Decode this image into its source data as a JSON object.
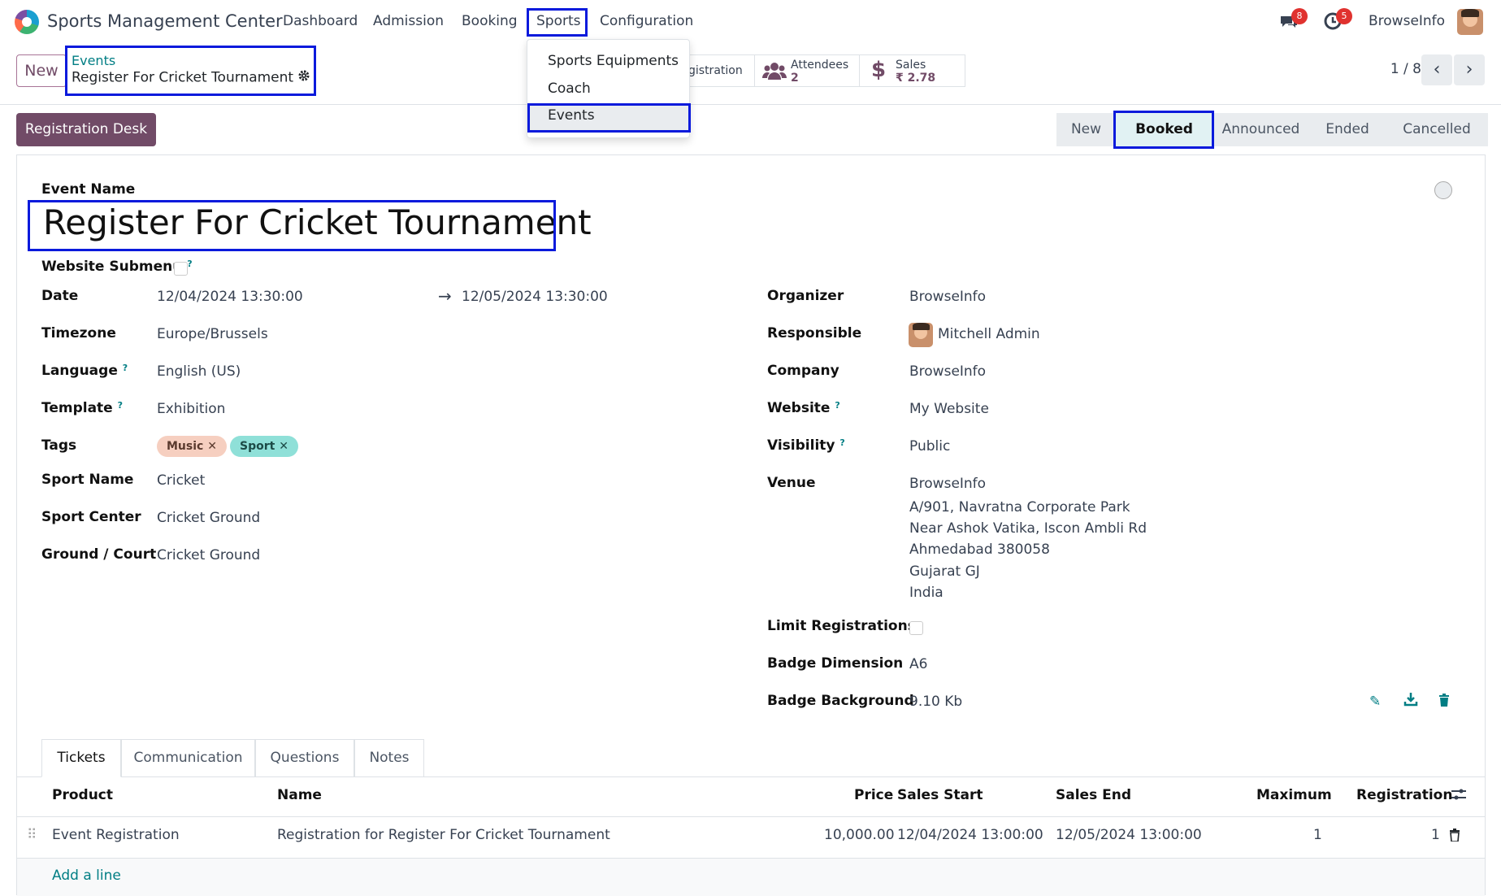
{
  "app": {
    "name": "Sports Management Center",
    "user": "BrowseInfo",
    "messages_count": "8",
    "activities_count": "5"
  },
  "menu": {
    "dashboard": "Dashboard",
    "admission": "Admission",
    "booking": "Booking",
    "sports": "Sports",
    "configuration": "Configuration"
  },
  "sports_dropdown": {
    "items": [
      "Sports Equipments",
      "Coach",
      "Events"
    ]
  },
  "control_panel": {
    "new_label": "New",
    "breadcrumb_root": "Events",
    "breadcrumb_current": "Register For Cricket Tournament",
    "stat_registration": "gistration",
    "stat_attendees_label": "Attendees",
    "stat_attendees_value": "2",
    "stat_sales_label": "Sales",
    "stat_sales_value": "₹ 2.78",
    "pager": "1 / 8"
  },
  "actions": {
    "registration_desk": "Registration Desk"
  },
  "stages": [
    "New",
    "Booked",
    "Announced",
    "Ended",
    "Cancelled"
  ],
  "form": {
    "event_name_label": "Event Name",
    "event_name": "Register For Cricket Tournament",
    "website_submenu_label": "Website Submenu",
    "date_label": "Date",
    "date_begin": "12/04/2024 13:30:00",
    "date_end": "12/05/2024 13:30:00",
    "timezone_label": "Timezone",
    "timezone": "Europe/Brussels",
    "language_label": "Language",
    "language": "English (US)",
    "template_label": "Template",
    "template": "Exhibition",
    "tags_label": "Tags",
    "tags": [
      "Music",
      "Sport"
    ],
    "sport_name_label": "Sport Name",
    "sport_name": "Cricket",
    "sport_center_label": "Sport Center",
    "sport_center": "Cricket Ground",
    "ground_label": "Ground / Court",
    "ground": "Cricket Ground",
    "organizer_label": "Organizer",
    "organizer": "BrowseInfo",
    "responsible_label": "Responsible",
    "responsible": "Mitchell Admin",
    "company_label": "Company",
    "company": "BrowseInfo",
    "website_label": "Website",
    "website": "My Website",
    "visibility_label": "Visibility",
    "visibility": "Public",
    "venue_label": "Venue",
    "venue_lines": [
      "BrowseInfo",
      "A/901, Navratna Corporate Park",
      "Near Ashok Vatika, Iscon Ambli Rd",
      "Ahmedabad 380058",
      "Gujarat GJ",
      "India"
    ],
    "limit_label": "Limit Registrations",
    "badge_dim_label": "Badge Dimension",
    "badge_dim": "A6",
    "badge_bg_label": "Badge Background",
    "badge_bg": "9.10 Kb"
  },
  "tabs": [
    "Tickets",
    "Communication",
    "Questions",
    "Notes"
  ],
  "tickets": {
    "headers": {
      "product": "Product",
      "name": "Name",
      "price": "Price",
      "sales_start": "Sales Start",
      "sales_end": "Sales End",
      "maximum": "Maximum",
      "registration": "Registration"
    },
    "rows": [
      {
        "product": "Event Registration",
        "name": "Registration for Register For Cricket Tournament",
        "price": "10,000.00",
        "sales_start": "12/04/2024 13:00:00",
        "sales_end": "12/05/2024 13:00:00",
        "maximum": "1",
        "registration": "1"
      }
    ],
    "add_line": "Add a line"
  },
  "colors": {
    "brand": "#714b67",
    "teal": "#017e84",
    "highlight": "#0a1adc"
  }
}
